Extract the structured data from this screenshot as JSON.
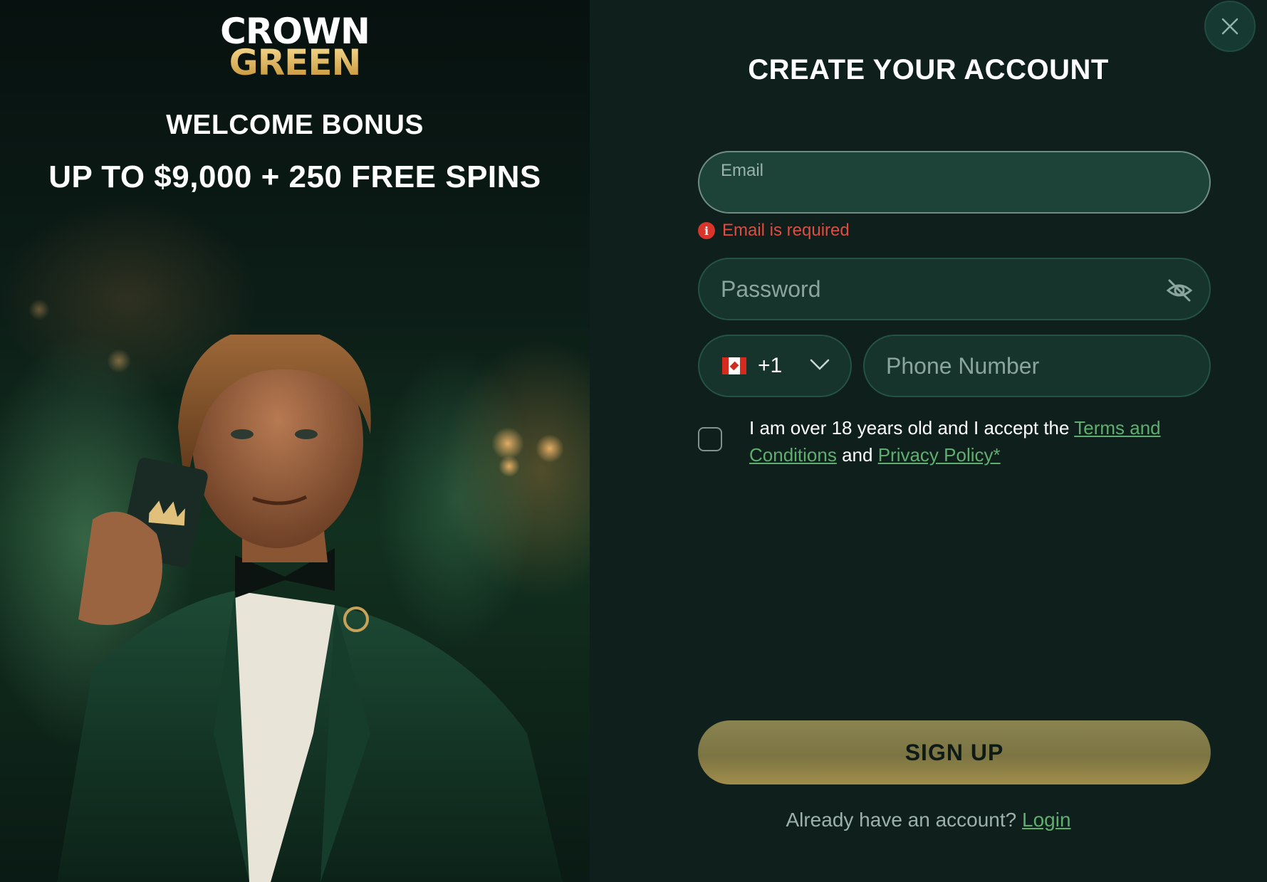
{
  "promo": {
    "logo_line1": "CROWN",
    "logo_line2": "GREEN",
    "bonus_title": "WELCOME BONUS",
    "bonus_offer": "UP TO $9,000 + 250 FREE SPINS"
  },
  "form": {
    "title": "CREATE YOUR ACCOUNT",
    "email": {
      "label": "Email",
      "value": "",
      "error": "Email is required"
    },
    "password": {
      "placeholder": "Password",
      "value": ""
    },
    "phone": {
      "country_code": "+1",
      "country_flag": "canada-flag-icon",
      "placeholder": "Phone Number",
      "value": ""
    },
    "consent": {
      "checked": false,
      "text_before": "I am over 18 years old and I accept the ",
      "terms_link": "Terms and Conditions",
      "text_middle": " and ",
      "privacy_link": "Privacy Policy*"
    },
    "signup_label": "SIGN UP",
    "login_prompt": "Already have an account? ",
    "login_link": "Login"
  },
  "colors": {
    "panel_bg": "#0f201c",
    "input_bg": "#16342c",
    "error": "#e24b3f",
    "link": "#5fae6f",
    "button_gold": "#8a8451"
  }
}
